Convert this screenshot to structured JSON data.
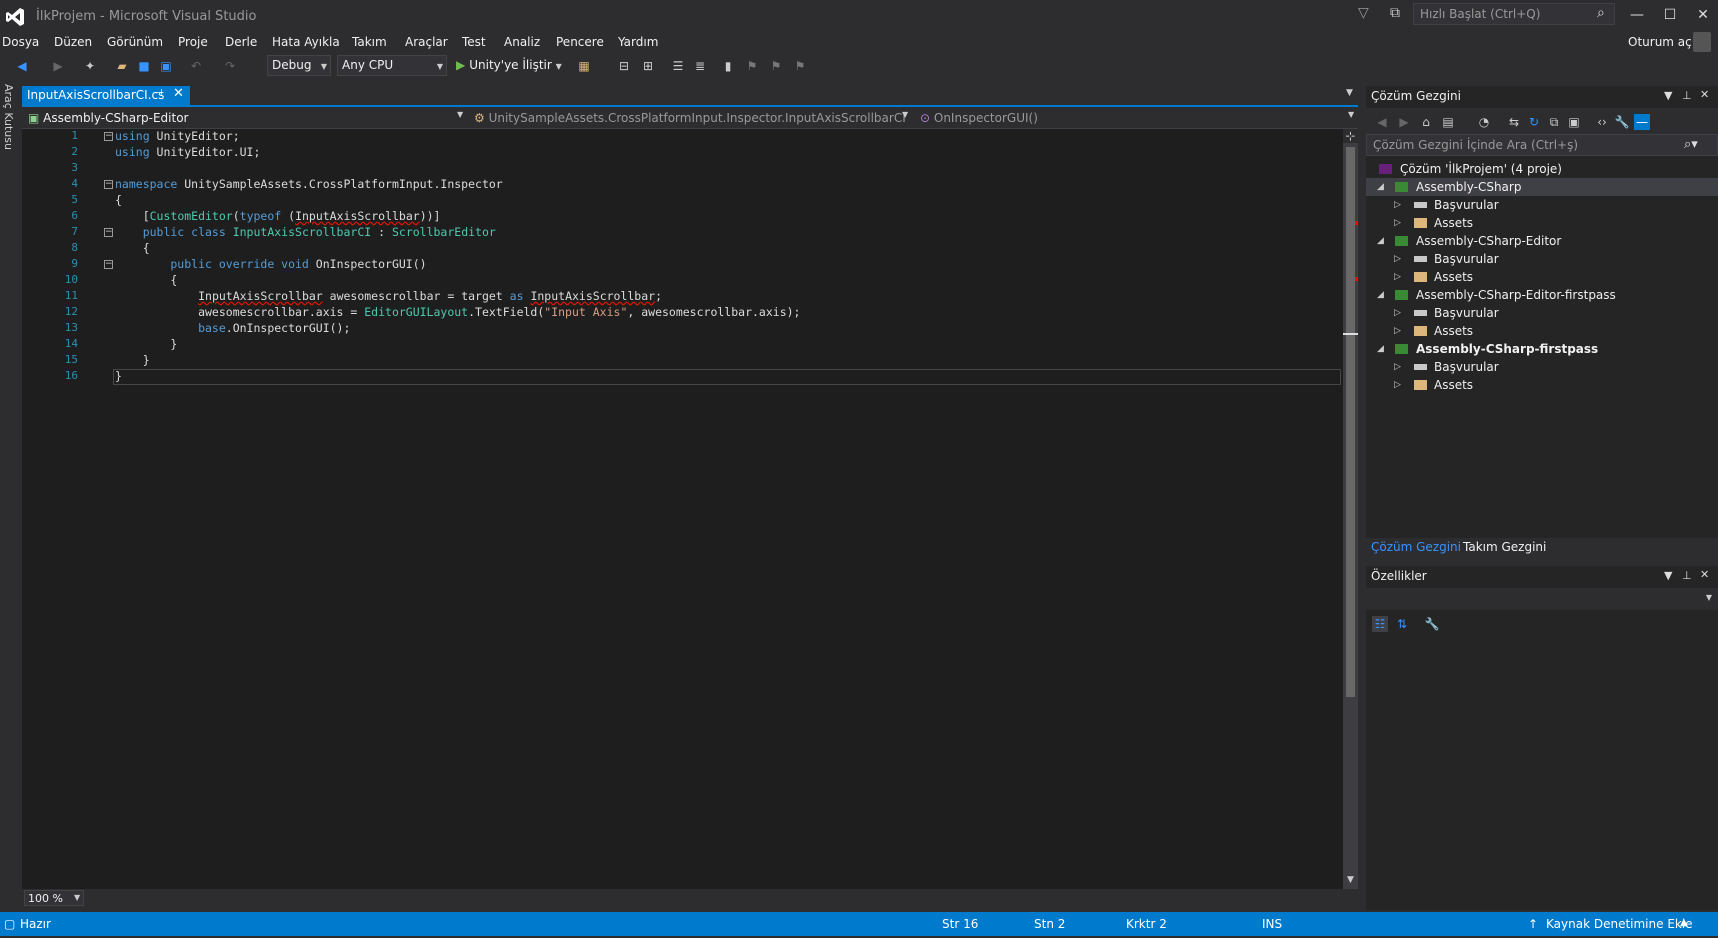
{
  "window": {
    "title": "İlkProjem - Microsoft Visual Studio",
    "quick_launch_placeholder": "Hızlı Başlat (Ctrl+Q)",
    "sign_in": "Oturum aç"
  },
  "menu": [
    "Dosya",
    "Düzen",
    "Görünüm",
    "Proje",
    "Derle",
    "Hata Ayıkla",
    "Takım",
    "Araçlar",
    "Test",
    "Analiz",
    "Pencere",
    "Yardım"
  ],
  "toolbar": {
    "config": "Debug",
    "platform": "Any CPU",
    "run": "Unity'ye İliştir"
  },
  "toolbox_label": "Araç Kutusu",
  "document": {
    "tab": "InputAxisScrollbarCI.cs",
    "project_combo": "Assembly-CSharp-Editor",
    "class_combo": "UnitySampleAssets.CrossPlatformInput.Inspector.InputAxisScrollbarCI",
    "member_combo": "OnInspectorGUI()"
  },
  "code": {
    "line_numbers": [
      "1",
      "2",
      "3",
      "4",
      "5",
      "6",
      "7",
      "8",
      "9",
      "10",
      "11",
      "12",
      "13",
      "14",
      "15",
      "16"
    ],
    "l1_kw": "using",
    "l1_rest": " UnityEditor;",
    "l2_kw": "using",
    "l2_rest": " UnityEditor.UI;",
    "l4_kw": "namespace",
    "l4_rest": " UnitySampleAssets.CrossPlatformInput.Inspector",
    "l5": "{",
    "l6_a": "    [",
    "l6_attr": "CustomEditor",
    "l6_b": "(",
    "l6_kw": "typeof",
    "l6_c": " (",
    "l6_err": "InputAxisScrollbar",
    "l6_d": "))]",
    "l7_kw": "    public class ",
    "l7_cls": "InputAxisScrollbarCI",
    "l7_b": " : ",
    "l7_base": "ScrollbarEditor",
    "l8": "    {",
    "l9_kw": "        public override void",
    "l9_rest": " OnInspectorGUI()",
    "l10": "        {",
    "l11_a": "            ",
    "l11_err1": "InputAxisScrollbar",
    "l11_b": " awesomescrollbar = target ",
    "l11_kw": "as",
    "l11_c": " ",
    "l11_err2": "InputAxisScrollbar",
    "l11_d": ";",
    "l12_a": "            awesomescrollbar.axis = ",
    "l12_ty": "EditorGUILayout",
    "l12_b": ".TextField(",
    "l12_str": "\"Input Axis\"",
    "l12_c": ", awesomescrollbar.axis);",
    "l13_kw": "            base",
    "l13_rest": ".OnInspectorGUI();",
    "l14": "        }",
    "l15": "    }",
    "l16": "}"
  },
  "zoom": "100 %",
  "solution_explorer": {
    "title": "Çözüm Gezgini",
    "search_placeholder": "Çözüm Gezgini İçinde Ara (Ctrl+ş)",
    "solution": "Çözüm 'İlkProjem' (4 proje)",
    "projects": [
      {
        "name": "Assembly-CSharp",
        "children": [
          "Başvurular",
          "Assets"
        ]
      },
      {
        "name": "Assembly-CSharp-Editor",
        "children": [
          "Başvurular",
          "Assets"
        ]
      },
      {
        "name": "Assembly-CSharp-Editor-firstpass",
        "children": [
          "Başvurular",
          "Assets"
        ]
      },
      {
        "name": "Assembly-CSharp-firstpass",
        "children": [
          "Başvurular",
          "Assets"
        ]
      }
    ],
    "tabs": [
      "Çözüm Gezgini",
      "Takım Gezgini"
    ]
  },
  "properties": {
    "title": "Özellikler"
  },
  "status": {
    "ready": "Hazır",
    "line": "Str 16",
    "col": "Stn 2",
    "char": "Krktr 2",
    "mode": "INS",
    "source_control": "Kaynak Denetimine Ekle"
  },
  "colors": {
    "accent": "#007acc",
    "editor_bg": "#1e1e1e",
    "keyword": "#569cd6",
    "type": "#4ec9b0",
    "string": "#d69d85"
  }
}
